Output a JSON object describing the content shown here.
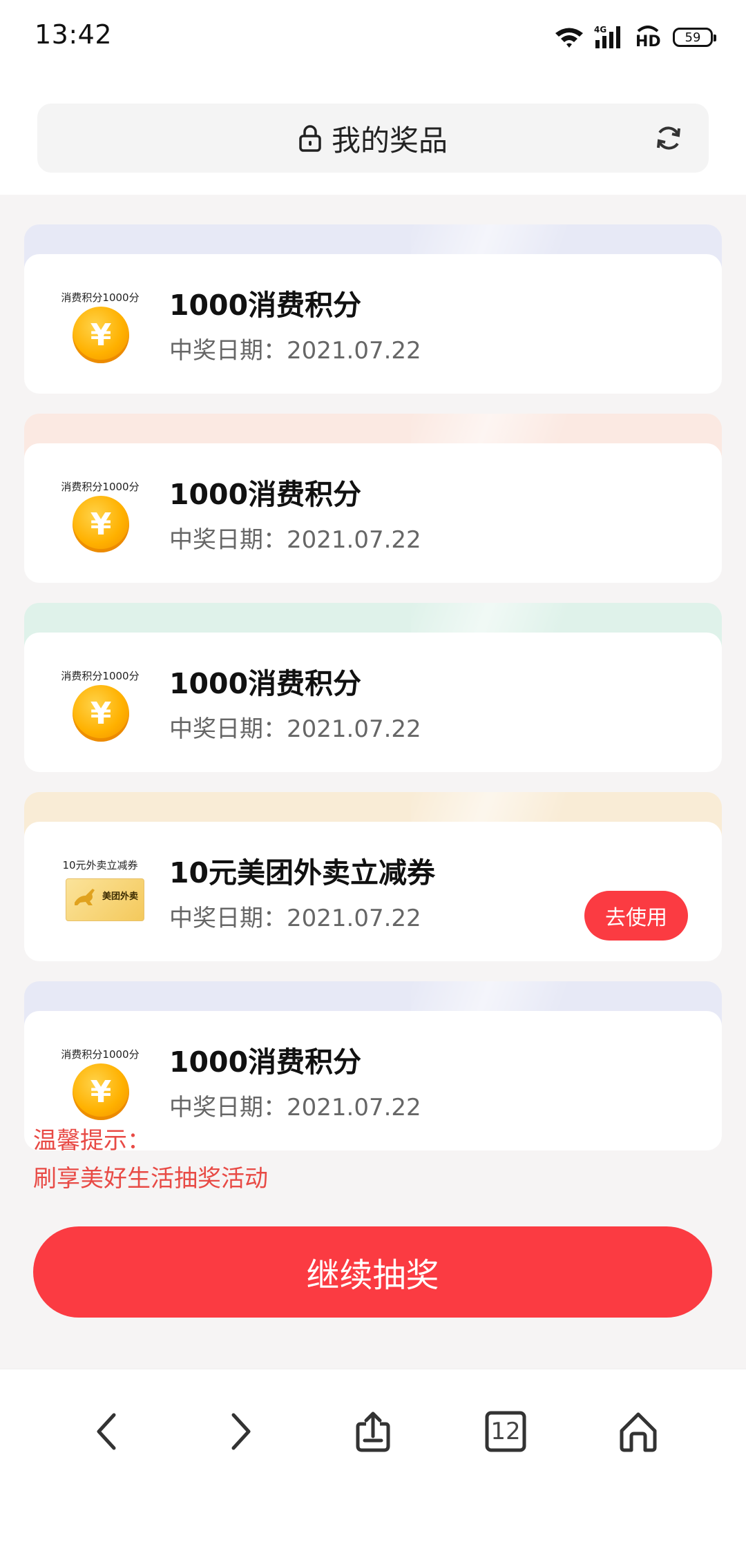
{
  "status": {
    "time": "13:42",
    "battery": "59",
    "network_label": "4G",
    "hd_label": "HD"
  },
  "address_bar": {
    "title": "我的奖品"
  },
  "prizes": [
    {
      "thumb_label": "消费积分1000分",
      "title": "1000消费积分",
      "date": "中奖日期：2021.07.22",
      "band_color": "#e7e9f6",
      "icon": "coin-icon"
    },
    {
      "thumb_label": "消费积分1000分",
      "title": "1000消费积分",
      "date": "中奖日期：2021.07.22",
      "band_color": "#fbe9e2",
      "icon": "coin-icon"
    },
    {
      "thumb_label": "消费积分1000分",
      "title": "1000消费积分",
      "date": "中奖日期：2021.07.22",
      "band_color": "#dff2ea",
      "icon": "coin-icon"
    },
    {
      "thumb_label": "10元外卖立减券",
      "title": "10元美团外卖立减券",
      "date": "中奖日期：2021.07.22",
      "band_color": "#f9ecd6",
      "icon": "voucher-icon",
      "voucher_brand": "美团外卖",
      "action": "去使用"
    },
    {
      "thumb_label": "消费积分1000分",
      "title": "1000消费积分",
      "date": "中奖日期：2021.07.22",
      "band_color": "#e7e9f6",
      "icon": "coin-icon"
    }
  ],
  "tips": {
    "heading": "温馨提示：",
    "text": "刷享美好生活抽奖活动"
  },
  "continue_label": "继续抽奖",
  "nav": {
    "tab_count": "12"
  },
  "colors": {
    "accent": "#fb3b42",
    "tip_text": "#e84a45",
    "content_bg": "#f6f4f4"
  }
}
